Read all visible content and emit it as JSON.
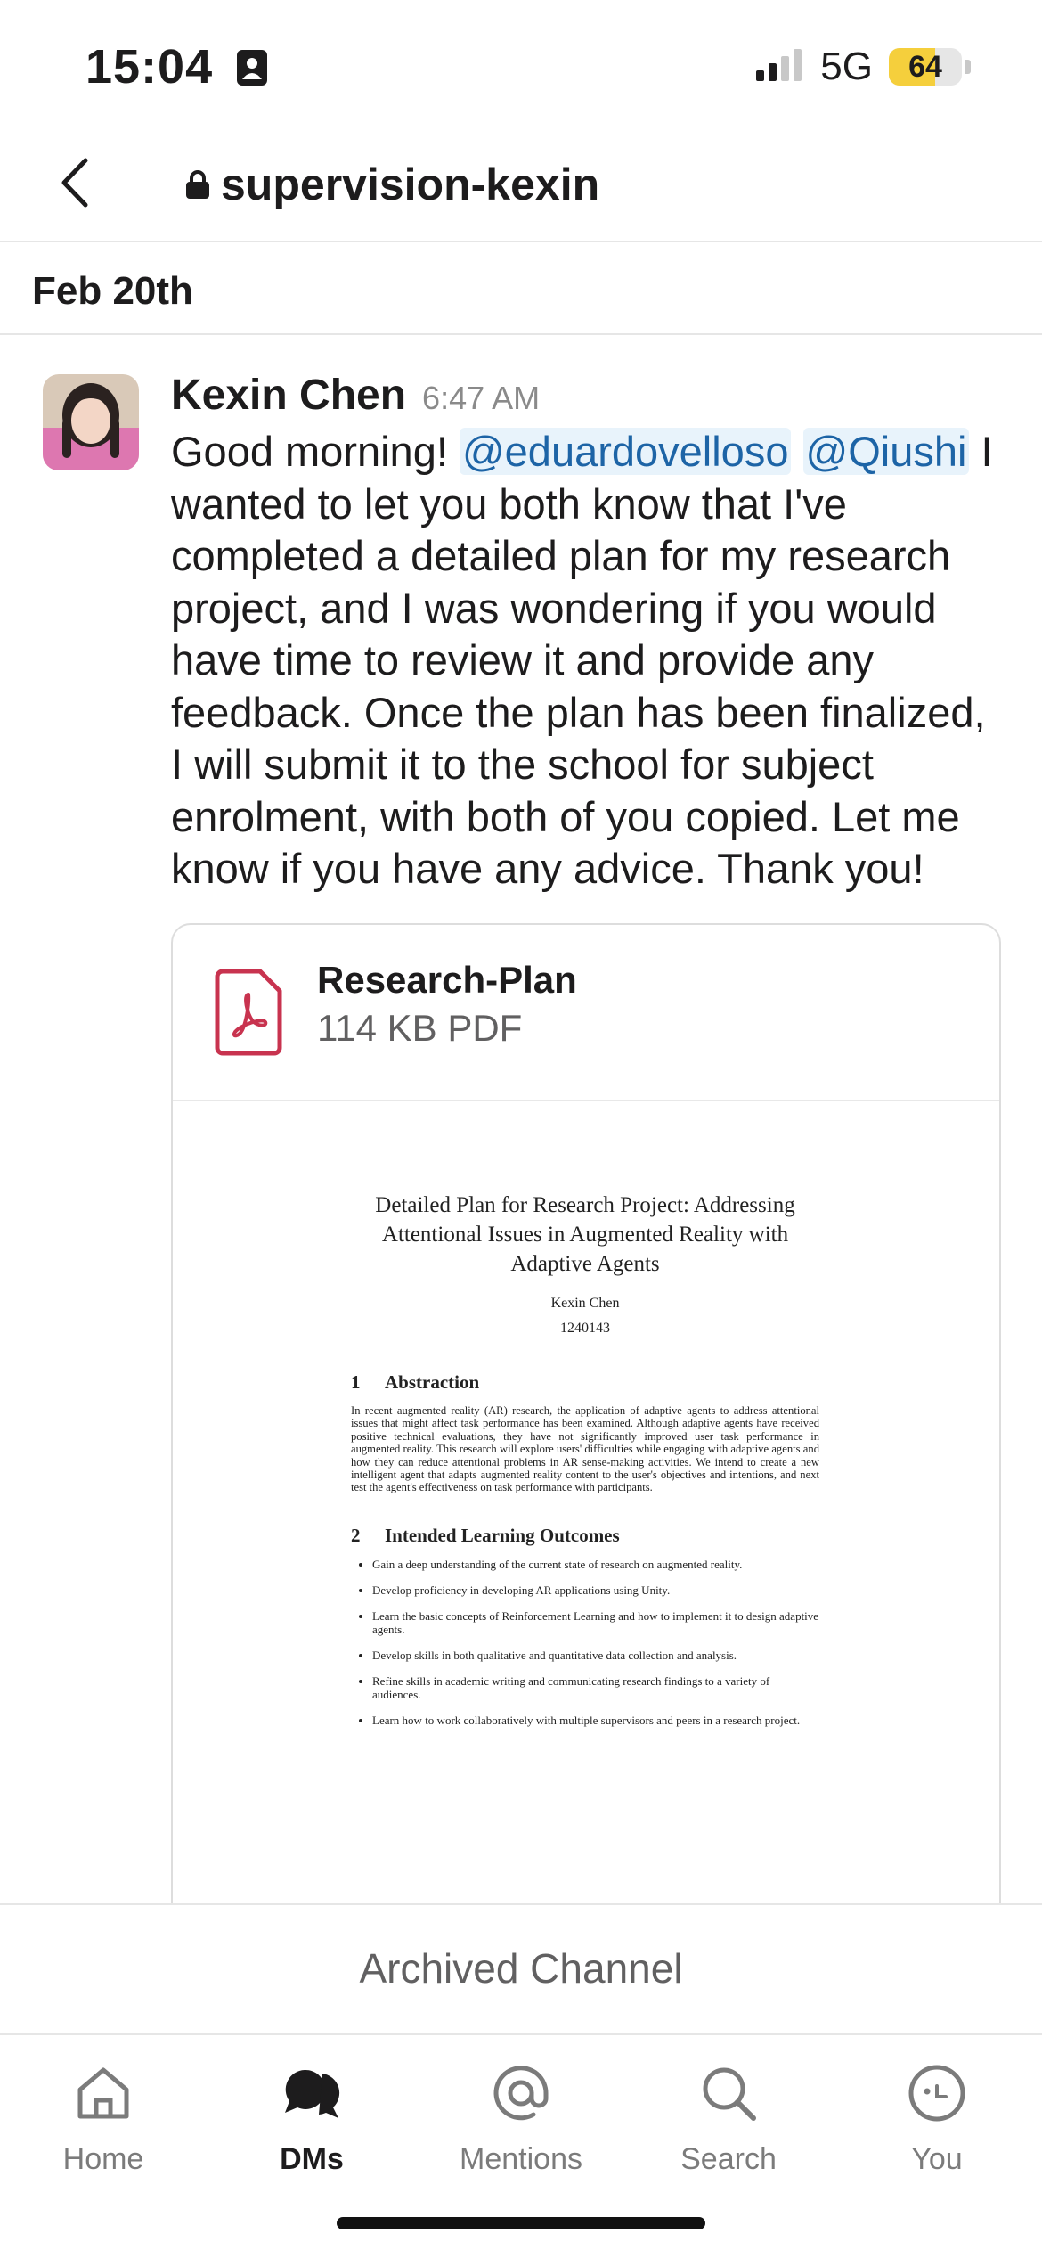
{
  "status_bar": {
    "time": "15:04",
    "network": "5G",
    "battery": "64"
  },
  "header": {
    "channel_name": "supervision-kexin"
  },
  "date_divider": "Feb 20th",
  "message": {
    "sender": "Kexin Chen",
    "time": "6:47 AM",
    "text_start": "Good morning! ",
    "mention1": "@eduardovelloso",
    "mention2": "@Qiushi",
    "text_rest": " I wanted to let you both know that I've completed a detailed plan for my research project, and I was wondering if you would have time to review it and provide any feedback. Once the plan has been finalized, I will submit it to the school for subject enrolment, with both of you copied. Let me know if you have any advice. Thank you!"
  },
  "attachment": {
    "file_name": "Research-Plan",
    "file_meta": "114 KB PDF",
    "preview": {
      "title": "Detailed Plan for Research Project: Addressing Attentional Issues in Augmented Reality with Adaptive Agents",
      "author": "Kexin Chen",
      "student_id": "1240143",
      "section1_num": "1",
      "section1_title": "Abstraction",
      "section1_text": "In recent augmented reality (AR) research, the application of adaptive agents to address attentional issues that might affect task performance has been examined. Although adaptive agents have received positive technical evaluations, they have not significantly improved user task performance in augmented reality. This research will explore users' difficulties while engaging with adaptive agents and how they can reduce attentional problems in AR sense-making activities. We intend to create a new intelligent agent that adapts augmented reality content to the user's objectives and intentions, and next test the agent's effectiveness on task performance with participants.",
      "section2_num": "2",
      "section2_title": "Intended Learning Outcomes",
      "outcomes": [
        "Gain a deep understanding of the current state of research on augmented reality.",
        "Develop proficiency in developing AR applications using Unity.",
        "Learn the basic concepts of Reinforcement Learning and how to implement it to design adaptive agents.",
        "Develop skills in both qualitative and quantitative data collection and analysis.",
        "Refine skills in academic writing and communicating research findings to a variety of audiences.",
        "Learn how to work collaboratively with multiple supervisors and peers in a research project."
      ]
    }
  },
  "archived_label": "Archived Channel",
  "tabs": [
    {
      "label": "Home",
      "icon": "home-icon"
    },
    {
      "label": "DMs",
      "icon": "dms-icon",
      "active": true
    },
    {
      "label": "Mentions",
      "icon": "at-icon"
    },
    {
      "label": "Search",
      "icon": "search-icon"
    },
    {
      "label": "You",
      "icon": "you-icon"
    }
  ],
  "colors": {
    "mention": "#1d64a6",
    "mention_bg": "#e8f3fb",
    "pdf_red": "#c8334f",
    "battery_yellow": "#f5cf3c"
  }
}
